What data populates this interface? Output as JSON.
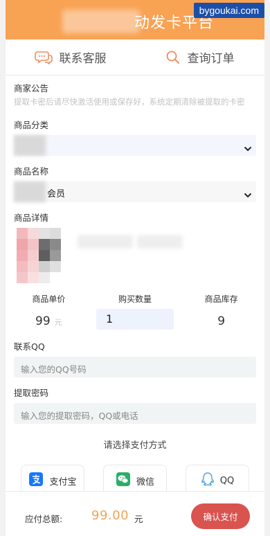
{
  "header": {
    "title": "动发卡平台",
    "watermark": "bygoukai.com"
  },
  "quick_nav": {
    "service_label": "联系客服",
    "order_label": "查询订单"
  },
  "notice": {
    "label": "商家公告",
    "text": "提取卡密后请尽快激活使用或保存好，系统定期清除被提取的卡密"
  },
  "category": {
    "label": "商品分类",
    "value": ""
  },
  "product": {
    "label": "商品名称",
    "value": "会员"
  },
  "detail": {
    "label": "商品详情"
  },
  "stats": {
    "price_label": "商品单价",
    "price_value": "99",
    "price_unit": "元",
    "qty_label": "购买数量",
    "qty_value": "1",
    "stock_label": "商品库存",
    "stock_value": "9"
  },
  "contact_qq": {
    "label": "联系QQ",
    "placeholder": "输入您的QQ号码"
  },
  "pickup_password": {
    "label": "提取密码",
    "placeholder": "输入您的提取密码，QQ或电话"
  },
  "payment": {
    "title": "请选择支付方式",
    "methods": [
      {
        "label": "支付宝",
        "icon": "alipay-icon"
      },
      {
        "label": "微信",
        "icon": "wechat-icon"
      },
      {
        "label": "QQ",
        "icon": "qq-icon"
      }
    ]
  },
  "footer": {
    "total_label": "应付总额:",
    "total_amount": "99.00",
    "total_unit": "元",
    "confirm_label": "确认支付"
  },
  "colors": {
    "header": "#f8a253",
    "accent": "#f3a454",
    "confirm": "#d9534f",
    "alipay": "#1677ff",
    "wechat": "#2aae67",
    "qq": "#4aa3e0"
  }
}
